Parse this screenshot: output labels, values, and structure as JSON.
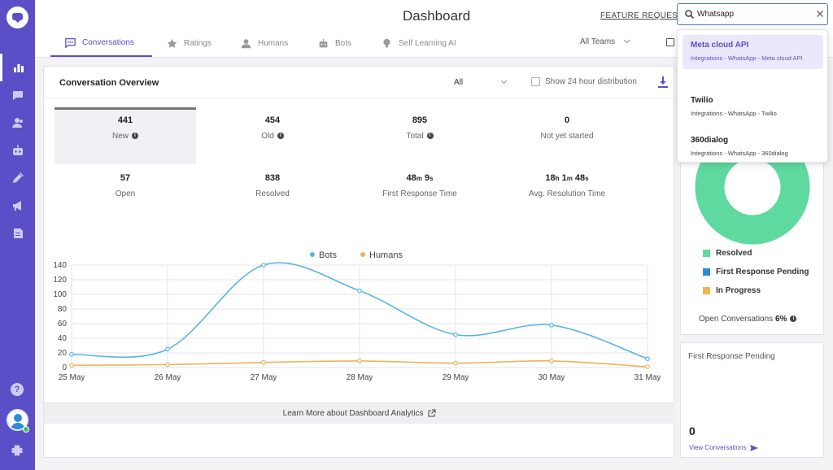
{
  "app": {
    "title": "Dashboard",
    "feature_request": "FEATURE REQUEST"
  },
  "sidebar": {
    "items": [
      {
        "icon": "chart-bars-icon",
        "active": true
      },
      {
        "icon": "chat-icon",
        "active": false
      },
      {
        "icon": "contacts-icon",
        "active": false
      },
      {
        "icon": "bot-icon",
        "active": false
      },
      {
        "icon": "integrations-icon",
        "active": false
      },
      {
        "icon": "megaphone-icon",
        "active": false
      },
      {
        "icon": "document-icon",
        "active": false
      }
    ],
    "help_icon": "?"
  },
  "tabs": [
    {
      "label": "Conversations",
      "icon": "chat-icon",
      "active": true
    },
    {
      "label": "Ratings",
      "icon": "star-icon",
      "active": false
    },
    {
      "label": "Humans",
      "icon": "person-icon",
      "active": false
    },
    {
      "label": "Bots",
      "icon": "bot-icon",
      "active": false
    },
    {
      "label": "Self Learning AI",
      "icon": "bulb-icon",
      "active": false
    }
  ],
  "team_filter": "All Teams",
  "overview": {
    "title": "Conversation Overview",
    "filter": "All",
    "toggle_label": "Show 24 hour distribution",
    "stats": [
      {
        "value": "441",
        "label": "New",
        "info": true,
        "selected": true
      },
      {
        "value": "454",
        "label": "Old",
        "info": true,
        "selected": false
      },
      {
        "value": "895",
        "label": "Total",
        "info": true,
        "selected": false
      },
      {
        "value": "0",
        "label": "Not yet started",
        "info": false,
        "selected": false
      },
      {
        "value": "57",
        "label": "Open",
        "info": false,
        "selected": false
      },
      {
        "value": "838",
        "label": "Resolved",
        "info": false,
        "selected": false
      },
      {
        "value_parts": [
          "48",
          "m",
          " 9",
          "s"
        ],
        "label": "First Response Time",
        "info": false,
        "selected": false
      },
      {
        "value_parts": [
          "18",
          "h",
          " 1",
          "m",
          " 48",
          "s"
        ],
        "label": "Avg. Resolution Time",
        "info": false,
        "selected": false
      }
    ],
    "learn_more": "Learn More about Dashboard Analytics"
  },
  "chart_data": {
    "type": "line",
    "x": [
      "25 May",
      "26 May",
      "27 May",
      "28 May",
      "29 May",
      "30 May",
      "31 May"
    ],
    "series": [
      {
        "name": "Bots",
        "color": "#5bb5e0",
        "values": [
          18,
          25,
          140,
          105,
          45,
          58,
          12
        ]
      },
      {
        "name": "Humans",
        "color": "#e8b45c",
        "values": [
          3,
          4,
          7,
          9,
          6,
          9,
          1
        ]
      }
    ],
    "ylim": [
      0,
      140
    ],
    "yticks": [
      0,
      20,
      40,
      60,
      80,
      100,
      120,
      140
    ],
    "grid": true,
    "legend": "top-center"
  },
  "donut": {
    "slices": [
      {
        "name": "Resolved",
        "value": 94,
        "color": "#5ed9a0"
      },
      {
        "name": "First Response Pending",
        "value": 0,
        "color": "#2d8ad6"
      },
      {
        "name": "In Progress",
        "value": 6,
        "color": "#f0b54e"
      }
    ],
    "slice_label": "6%",
    "open_label": "Open Conversations",
    "open_value": "6%"
  },
  "first_response": {
    "title": "First Response Pending",
    "value": "0",
    "link": "View Conversations"
  },
  "search": {
    "value": "Whatsapp",
    "results": [
      {
        "title": "Meta cloud API",
        "path": "Integrations - WhatsApp - Meta cloud API",
        "highlighted": true
      },
      {
        "title": "Twilio",
        "path": "Integrations - WhatsApp - Twilio",
        "highlighted": false
      },
      {
        "title": "360dialog",
        "path": "Integrations - WhatsApp - 360dialog",
        "highlighted": false
      }
    ]
  }
}
